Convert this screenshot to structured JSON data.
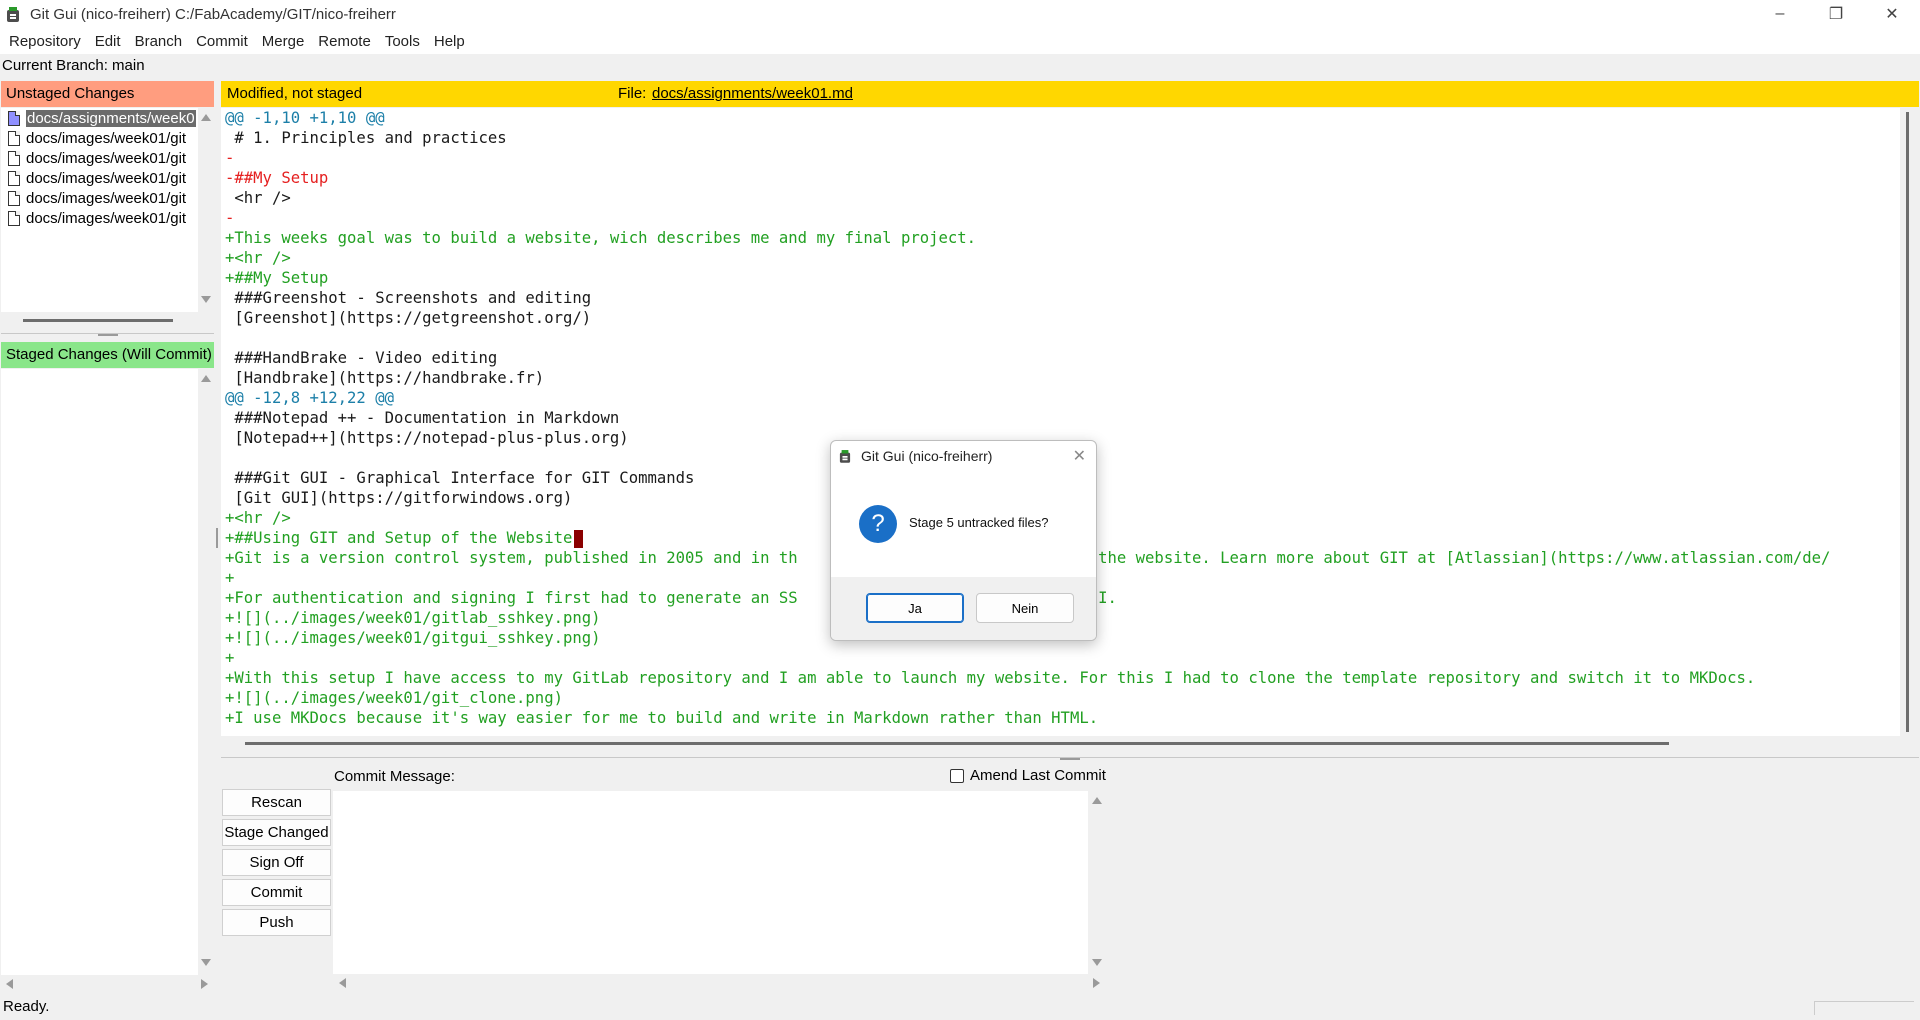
{
  "window": {
    "title": "Git Gui (nico-freiherr) C:/FabAcademy/GIT/nico-freiherr",
    "controls": [
      "minimize-icon",
      "restore-icon",
      "close-icon"
    ]
  },
  "menu": [
    "Repository",
    "Edit",
    "Branch",
    "Commit",
    "Merge",
    "Remote",
    "Tools",
    "Help"
  ],
  "branch_label": "Current Branch: main",
  "unstaged": {
    "header": "Unstaged Changes",
    "files": [
      "docs/assignments/week0",
      "docs/images/week01/git",
      "docs/images/week01/git",
      "docs/images/week01/git",
      "docs/images/week01/git",
      "docs/images/week01/git"
    ]
  },
  "staged": {
    "header": "Staged Changes (Will Commit)"
  },
  "diff": {
    "status": "Modified, not staged",
    "file_label": "File:",
    "file_path": "docs/assignments/week01.md",
    "lines": [
      {
        "t": "hunk",
        "s": "@@ -1,10 +1,10 @@"
      },
      {
        "t": "ctx",
        "s": " # 1. Principles and practices"
      },
      {
        "t": "del",
        "s": "-"
      },
      {
        "t": "del",
        "s": "-##My Setup"
      },
      {
        "t": "ctx",
        "s": " <hr />"
      },
      {
        "t": "del",
        "s": "-"
      },
      {
        "t": "add",
        "s": "+This weeks goal was to build a website, wich describes me and my final project."
      },
      {
        "t": "add",
        "s": "+<hr />"
      },
      {
        "t": "add",
        "s": "+##My Setup"
      },
      {
        "t": "ctx",
        "s": " ###Greenshot - Screenshots and editing"
      },
      {
        "t": "ctx",
        "s": " [Greenshot](https://getgreenshot.org/)"
      },
      {
        "t": "ctx",
        "s": ""
      },
      {
        "t": "ctx",
        "s": " ###HandBrake - Video editing"
      },
      {
        "t": "ctx",
        "s": " [Handbrake](https://handbrake.fr)"
      },
      {
        "t": "hunk",
        "s": "@@ -12,8 +12,22 @@"
      },
      {
        "t": "ctx",
        "s": " ###Notepad ++ - Documentation in Markdown"
      },
      {
        "t": "ctx",
        "s": " [Notepad++](https://notepad-plus-plus.org)"
      },
      {
        "t": "ctx",
        "s": ""
      },
      {
        "t": "ctx",
        "s": " ###Git GUI - Graphical Interface for GIT Commands"
      },
      {
        "t": "ctx",
        "s": " [Git GUI](https://gitforwindows.org)"
      },
      {
        "t": "add",
        "s": "+<hr />"
      },
      {
        "t": "add",
        "s": "+##Using GIT and Setup of the Website",
        "cursor": true
      },
      {
        "t": "add",
        "s": "+Git is a version control system, published in 2005 and in th                              p the website. Learn more about GIT at [Atlassian](https://www.atlassian.com/de/"
      },
      {
        "t": "add",
        "s": "+"
      },
      {
        "t": "add",
        "s": "+For authentication and signing I first had to generate an SS                                I."
      },
      {
        "t": "add",
        "s": "+![](../images/week01/gitlab_sshkey.png)"
      },
      {
        "t": "add",
        "s": "+![](../images/week01/gitgui_sshkey.png)"
      },
      {
        "t": "add",
        "s": "+"
      },
      {
        "t": "add",
        "s": "+With this setup I have access to my GitLab repository and I am able to launch my website. For this I had to clone the template repository and switch it to MKDocs."
      },
      {
        "t": "add",
        "s": "+![](../images/week01/git_clone.png)"
      },
      {
        "t": "add",
        "s": "+I use MKDocs because it's way easier for me to build and write in Markdown rather than HTML."
      }
    ]
  },
  "commit": {
    "message_label": "Commit Message:",
    "amend_label": "Amend Last Commit",
    "buttons": [
      "Rescan",
      "Stage Changed",
      "Sign Off",
      "Commit",
      "Push"
    ]
  },
  "status": "Ready.",
  "dialog": {
    "title": "Git Gui (nico-freiherr)",
    "message": "Stage 5 untracked files?",
    "icon": "question-icon",
    "yes_label": "Ja",
    "no_label": "Nein"
  },
  "colors": {
    "unstaged_header": "#ff9d7f",
    "staged_header": "#8ae68a",
    "diff_header": "#ffd700",
    "diff_add": "#22a022",
    "diff_del": "#e52020",
    "diff_hunk": "#1c7fa8"
  }
}
